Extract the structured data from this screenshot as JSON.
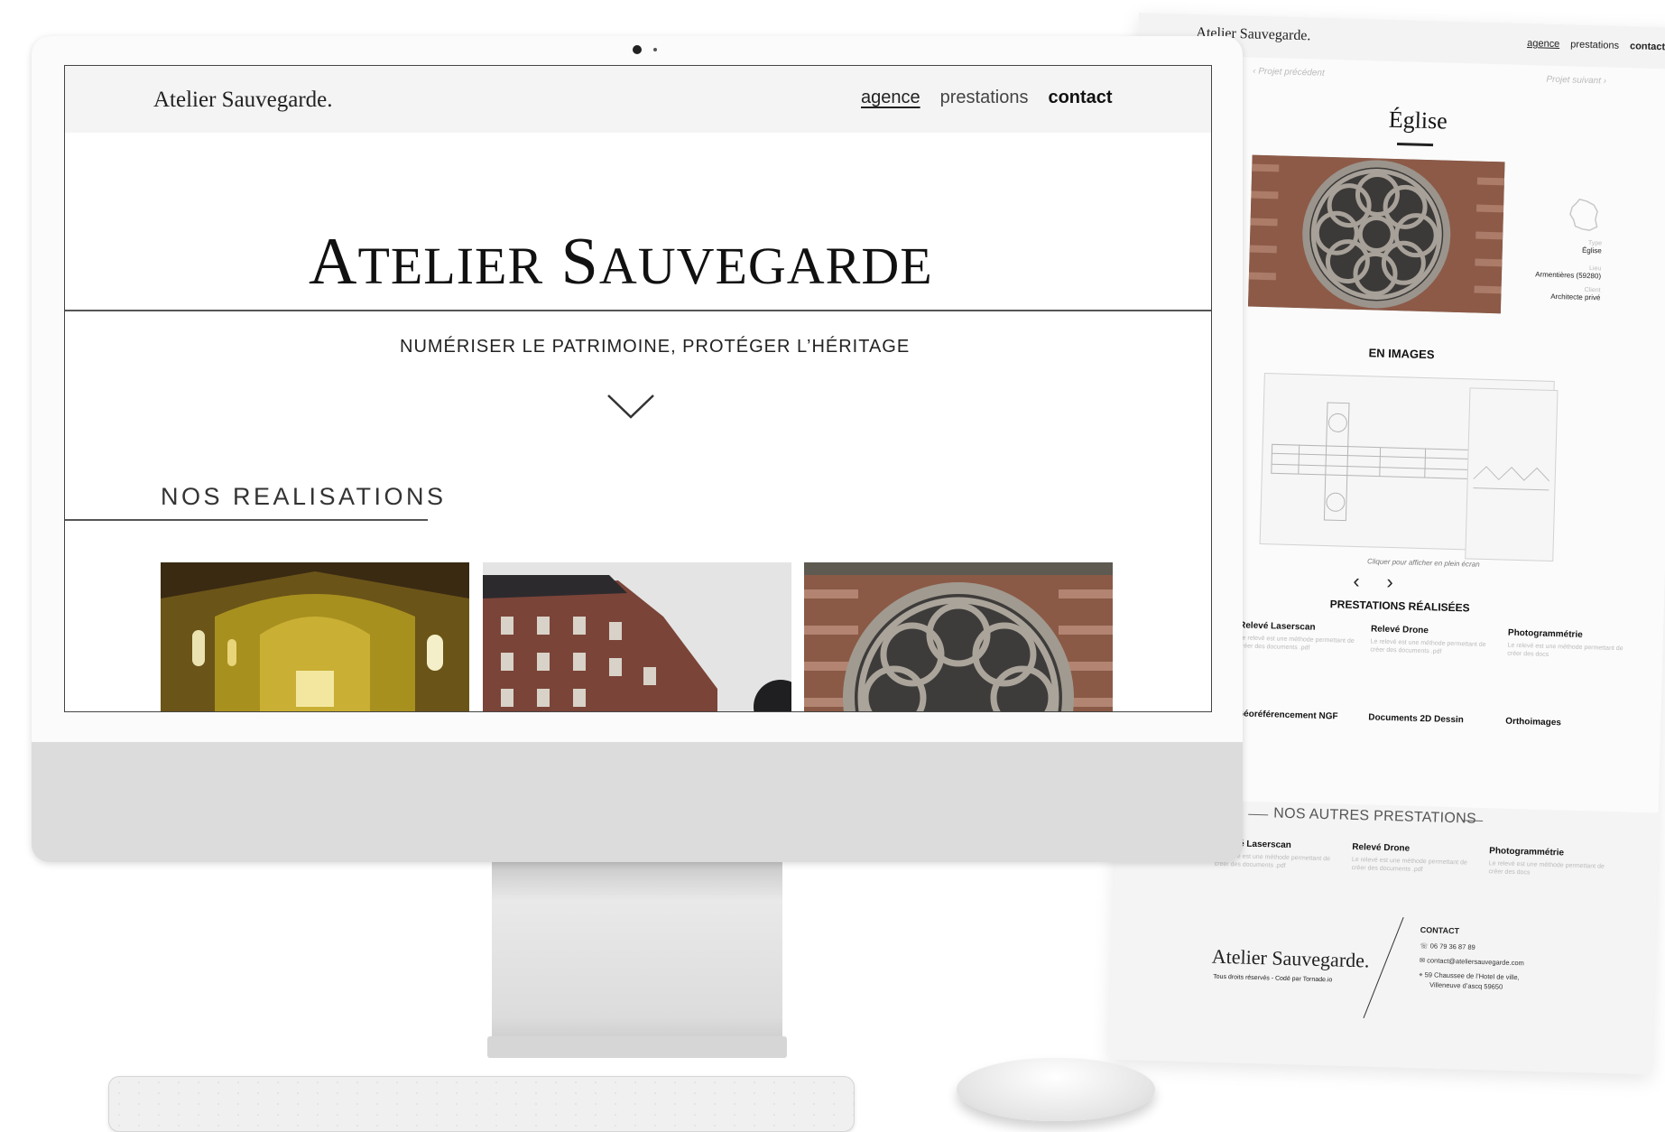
{
  "site": {
    "logo": "Atelier Sauvegarde.",
    "nav": [
      {
        "label": "agence"
      },
      {
        "label": "prestations"
      },
      {
        "label": "contact"
      }
    ]
  },
  "hero": {
    "title_first_letter_1": "A",
    "title_rest_1": "TELIER",
    "title_first_letter_2": "S",
    "title_rest_2": "AUVEGARDE",
    "tagline": "NUMÉRISER LE PATRIMOINE, PROTÉGER L’HÉRITAGE"
  },
  "realisations": {
    "heading": "NOS REALISATIONS",
    "thumbnails": [
      {
        "name": "church-interior"
      },
      {
        "name": "haussmann-building"
      },
      {
        "name": "rose-window"
      }
    ]
  },
  "project_page": {
    "logo": "Atelier Sauvegarde.",
    "nav": [
      "agence",
      "prestations",
      "contact"
    ],
    "prev": "Projet précédent",
    "next": "Projet suivant",
    "title": "Église",
    "meta": [
      {
        "key": "Type",
        "value": "Église"
      },
      {
        "key": "Lieu",
        "value": "Armentières (59280)"
      },
      {
        "key": "Client",
        "value": "Architecte privé"
      }
    ],
    "en_images": "EN IMAGES",
    "caption": "Cliquer pour afficher en plein écran",
    "prestations_heading": "PRESTATIONS RÉALISÉES",
    "prestations": [
      {
        "name": "Relevé Laserscan",
        "desc": "Le relevé est une méthode permettant de créer des documents .pdf"
      },
      {
        "name": "Relevé Drone",
        "desc": "Le relevé est une méthode permettant de créer des documents .pdf"
      },
      {
        "name": "Photogrammétrie",
        "desc": "Le relevé est une méthode permettant de créer des docs"
      },
      {
        "name": "Géoréférencement NGF",
        "desc": ""
      },
      {
        "name": "Documents 2D Dessin",
        "desc": ""
      },
      {
        "name": "Orthoimages",
        "desc": ""
      }
    ],
    "autres_heading": "NOS AUTRES PRESTATIONS",
    "autres": [
      {
        "name": "Relevé Laserscan",
        "desc": "Le relevé est une méthode permettant de créer des documents .pdf"
      },
      {
        "name": "Relevé Drone",
        "desc": "Le relevé est une méthode permettant de créer des documents .pdf"
      },
      {
        "name": "Photogrammétrie",
        "desc": "Le relevé est une méthode permettant de créer des docs"
      }
    ],
    "footer": {
      "logo": "Atelier Sauvegarde.",
      "rights": "Tous droits réservés - Codé par Tornade.io",
      "contact_heading": "CONTACT",
      "phone": "06 79 36 87 89",
      "email": "contact@ateliersauvegarde.com",
      "address_1": "59 Chaussee de l’Hotel de ville,",
      "address_2": "Villeneuve d’ascq 59650"
    }
  },
  "colors": {
    "accent": "#111111",
    "header_bg": "#f4f4f4",
    "device_silver": "#dcdcdc"
  }
}
